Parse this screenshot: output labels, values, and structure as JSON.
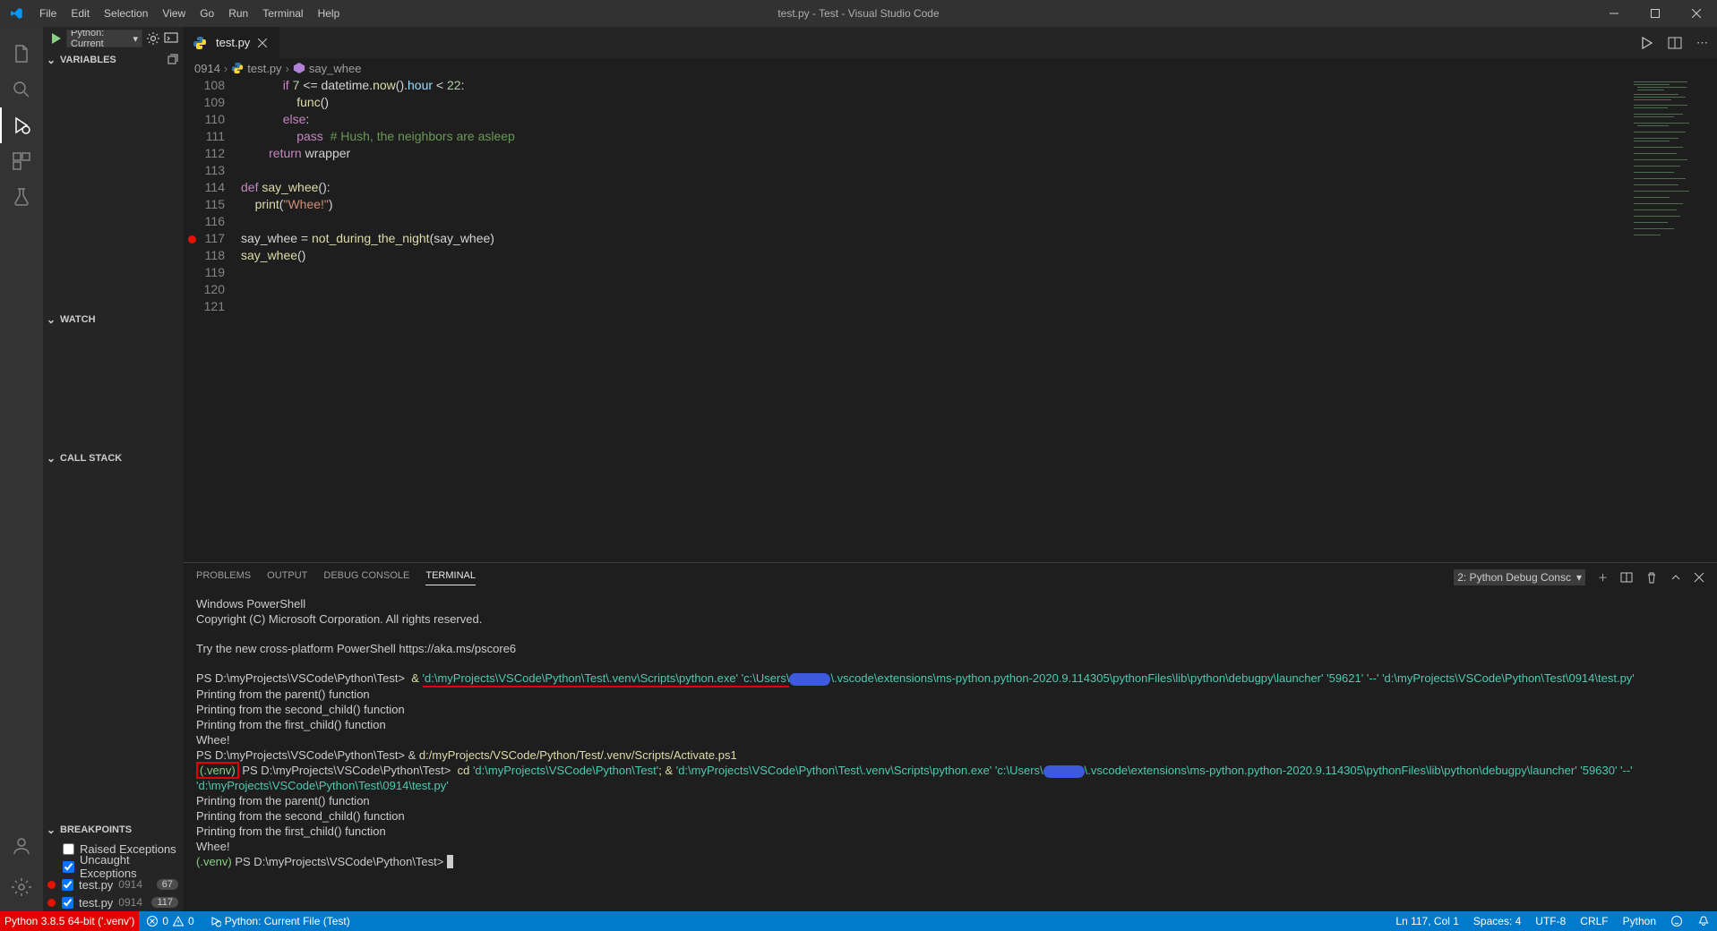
{
  "title": "test.py - Test - Visual Studio Code",
  "menu": [
    "File",
    "Edit",
    "Selection",
    "View",
    "Go",
    "Run",
    "Terminal",
    "Help"
  ],
  "debug_config": "Python: Current",
  "sidebar": {
    "variables_header": "VARIABLES",
    "watch_header": "WATCH",
    "callstack_header": "CALL STACK",
    "breakpoints_header": "BREAKPOINTS",
    "raised_exceptions": "Raised Exceptions",
    "uncaught_exceptions": "Uncaught Exceptions",
    "bp_file": "test.py",
    "bp_folder": "0914",
    "bp_line_a": "67",
    "bp_line_b": "117"
  },
  "tab_name": "test.py",
  "breadcrumb": {
    "folder": "0914",
    "file": "test.py",
    "symbol": "say_whee"
  },
  "code_lines": [
    {
      "no": 108,
      "parts": [
        [
          "            ",
          ""
        ],
        [
          "if",
          "k"
        ],
        [
          " ",
          ""
        ],
        [
          "7",
          "n"
        ],
        [
          " <= ",
          ""
        ],
        [
          "datetime",
          ""
        ],
        [
          ".",
          ""
        ],
        [
          "now",
          "f"
        ],
        [
          "().",
          ""
        ],
        [
          "hour",
          "v"
        ],
        [
          " < ",
          ""
        ],
        [
          "22",
          "n"
        ],
        [
          ":",
          ""
        ]
      ]
    },
    {
      "no": 109,
      "parts": [
        [
          "                ",
          ""
        ],
        [
          "func",
          "f"
        ],
        [
          "()",
          ""
        ]
      ]
    },
    {
      "no": 110,
      "parts": [
        [
          "            ",
          ""
        ],
        [
          "else",
          "k"
        ],
        [
          ":",
          ""
        ]
      ]
    },
    {
      "no": 111,
      "parts": [
        [
          "                ",
          ""
        ],
        [
          "pass",
          "k"
        ],
        [
          "  ",
          ""
        ],
        [
          "# Hush, the neighbors are asleep",
          "c"
        ]
      ]
    },
    {
      "no": 112,
      "parts": [
        [
          "        ",
          ""
        ],
        [
          "return",
          "k"
        ],
        [
          " ",
          ""
        ],
        [
          "wrapper",
          ""
        ]
      ]
    },
    {
      "no": 113,
      "parts": []
    },
    {
      "no": 114,
      "parts": [
        [
          "",
          ""
        ],
        [
          "def",
          "k"
        ],
        [
          " ",
          ""
        ],
        [
          "say_whee",
          "f"
        ],
        [
          "():",
          ""
        ]
      ]
    },
    {
      "no": 115,
      "parts": [
        [
          "    ",
          ""
        ],
        [
          "print",
          "f"
        ],
        [
          "(",
          ""
        ],
        [
          "\"Whee!\"",
          "s"
        ],
        [
          ")",
          ""
        ]
      ]
    },
    {
      "no": 116,
      "parts": []
    },
    {
      "no": 117,
      "bp": true,
      "parts": [
        [
          "",
          ""
        ],
        [
          "say_whee",
          ""
        ],
        [
          " = ",
          ""
        ],
        [
          "not_during_the_night",
          "f"
        ],
        [
          "(",
          ""
        ],
        [
          "say_whee",
          ""
        ],
        [
          ")",
          ""
        ]
      ]
    },
    {
      "no": 118,
      "parts": [
        [
          "",
          ""
        ],
        [
          "say_whee",
          "f"
        ],
        [
          "()",
          ""
        ]
      ]
    },
    {
      "no": 119,
      "parts": []
    },
    {
      "no": 120,
      "parts": []
    },
    {
      "no": 121,
      "parts": []
    }
  ],
  "panel": {
    "tabs": [
      "PROBLEMS",
      "OUTPUT",
      "DEBUG CONSOLE",
      "TERMINAL"
    ],
    "active_tab": "TERMINAL",
    "term_select": "2: Python Debug Consc"
  },
  "terminal": {
    "l1": "Windows PowerShell",
    "l2": "Copyright (C) Microsoft Corporation. All rights reserved.",
    "l3": "Try the new cross-platform PowerShell https://aka.ms/pscore6",
    "ps1": "PS D:\\myProjects\\VSCode\\Python\\Test> ",
    "amp": " & ",
    "path1": "'d:\\myProjects\\VSCode\\Python\\Test\\.venv\\Scripts\\python.exe' 'c:\\Users\\",
    "path1b": "\\.vscode\\extensions\\ms-python.python-2020.9.114305\\pythonFiles\\lib\\python\\debugpy\\launcher' '59621' '--' 'd:\\myProjects\\VSCode\\Python\\Test\\0914\\test.py'",
    "out1": "Printing from the parent() function",
    "out2": "Printing from the second_child() function",
    "out3": "Printing from the first_child() function",
    "out4": "Whee!",
    "activate_pre": "PS D:\\myProjects\\VSCode\\Python\\Test> & ",
    "activate": "d:/myProjects/VSCode/Python/Test/.venv/Scripts/Activate.ps1",
    "venv_prefix": "(.venv)",
    "ps2": " PS D:\\myProjects\\VSCode\\Python\\Test> ",
    "cd": " cd ",
    "cd_path": "'d:\\myProjects\\VSCode\\Python\\Test'",
    "semi": "; & ",
    "launch2a": "'d:\\myProjects\\VSCode\\Python\\Test\\.venv\\Scripts\\python.exe' 'c:\\Users\\",
    "launch2b": "\\.vscode\\extensions\\ms-python.python-2020.9.114305\\pythonFiles\\lib\\python\\debugpy\\launcher' '59630' '--' 'd:\\myProjects\\VSCode\\Python\\Test\\0914\\test.py'",
    "final_prefix": "(.venv)",
    "final_ps": " PS D:\\myProjects\\VSCode\\Python\\Test> ",
    "cursor": "▮"
  },
  "status": {
    "python_interpreter": "Python 3.8.5 64-bit ('.venv')",
    "errors": "0",
    "warnings": "0",
    "debug_config": "Python: Current File (Test)",
    "ln_col": "Ln 117, Col 1",
    "spaces": "Spaces: 4",
    "encoding": "UTF-8",
    "eol": "CRLF",
    "language": "Python"
  }
}
